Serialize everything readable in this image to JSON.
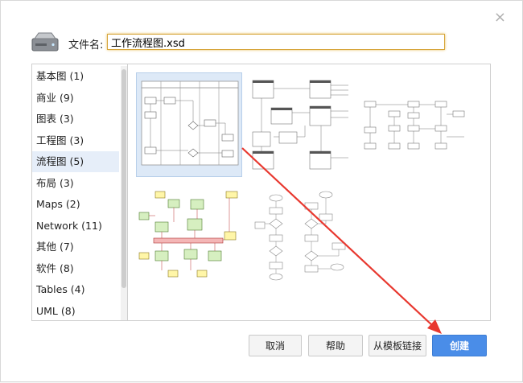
{
  "close_icon_glyph": "×",
  "file_label": "文件名:",
  "file_value": "工作流程图.xsd",
  "categories": [
    {
      "label": "基本图 (1)"
    },
    {
      "label": "商业 (9)"
    },
    {
      "label": "图表 (3)"
    },
    {
      "label": "工程图 (3)"
    },
    {
      "label": "流程图 (5)",
      "selected": true
    },
    {
      "label": "布局 (3)"
    },
    {
      "label": "Maps (2)"
    },
    {
      "label": "Network (11)"
    },
    {
      "label": "其他 (7)"
    },
    {
      "label": "软件 (8)"
    },
    {
      "label": "Tables (4)"
    },
    {
      "label": "UML (8)"
    }
  ],
  "buttons": {
    "cancel": "取消",
    "help": "帮助",
    "from_link": "从模板链接",
    "create": "创建"
  },
  "colors": {
    "accent": "#4a8de8",
    "selected_bg": "#dde9f7",
    "arrow": "#e8382f",
    "template_box_fill": "#d6efc0",
    "template_bar_fill": "#f4b6b6"
  }
}
